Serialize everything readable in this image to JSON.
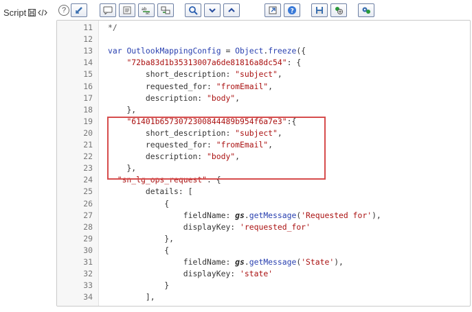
{
  "field": {
    "label": "Script",
    "save_icon": "save-icon",
    "code_icon": "code-icon",
    "help_text": "?"
  },
  "toolbar": {
    "buttons": [
      {
        "name": "toggle-fullscreen-icon"
      },
      {
        "name": "comment-icon"
      },
      {
        "name": "format-code-icon"
      },
      {
        "name": "replace-icon"
      },
      {
        "name": "replace-all-icon"
      },
      {
        "name": "search-icon"
      },
      {
        "name": "find-next-icon"
      },
      {
        "name": "find-previous-icon"
      },
      {
        "name": "open-icon"
      },
      {
        "name": "help-icon"
      },
      {
        "name": "save-icon"
      },
      {
        "name": "script-debugger-icon"
      },
      {
        "name": "settings-icon"
      }
    ]
  },
  "editor": {
    "lines": [
      {
        "n": "11",
        "t": [
          [
            "com",
            "*/"
          ]
        ]
      },
      {
        "n": "12",
        "t": []
      },
      {
        "n": "13",
        "t": [
          [
            "kw",
            "var "
          ],
          [
            "var",
            "OutlookMappingConfig"
          ],
          [
            "p",
            " = "
          ],
          [
            "var",
            "Object"
          ],
          [
            "p",
            "."
          ],
          [
            "var",
            "freeze"
          ],
          [
            "p",
            "({"
          ]
        ]
      },
      {
        "n": "14",
        "t": [
          [
            "p",
            "    "
          ],
          [
            "str",
            "\"72ba83d1b35313007a6de81816a8dc54\""
          ],
          [
            "p",
            ": {"
          ]
        ]
      },
      {
        "n": "15",
        "t": [
          [
            "p",
            "        short_description: "
          ],
          [
            "str",
            "\"subject\""
          ],
          [
            "p",
            ","
          ]
        ]
      },
      {
        "n": "16",
        "t": [
          [
            "p",
            "        requested_for: "
          ],
          [
            "str",
            "\"fromEmail\""
          ],
          [
            "p",
            ","
          ]
        ]
      },
      {
        "n": "17",
        "t": [
          [
            "p",
            "        description: "
          ],
          [
            "str",
            "\"body\""
          ],
          [
            "p",
            ","
          ]
        ]
      },
      {
        "n": "18",
        "t": [
          [
            "p",
            "    },"
          ]
        ]
      },
      {
        "n": "19",
        "t": [
          [
            "p",
            "    "
          ],
          [
            "str",
            "\"61401b6573072300844489b954f6a7e3\""
          ],
          [
            "p",
            ":{"
          ]
        ]
      },
      {
        "n": "20",
        "t": [
          [
            "p",
            "        short_description: "
          ],
          [
            "str",
            "\"subject\""
          ],
          [
            "p",
            ","
          ]
        ]
      },
      {
        "n": "21",
        "t": [
          [
            "p",
            "        requested_for: "
          ],
          [
            "str",
            "\"fromEmail\""
          ],
          [
            "p",
            ","
          ]
        ]
      },
      {
        "n": "22",
        "t": [
          [
            "p",
            "        description: "
          ],
          [
            "str",
            "\"body\""
          ],
          [
            "p",
            ","
          ]
        ]
      },
      {
        "n": "23",
        "t": [
          [
            "p",
            "    },"
          ]
        ]
      },
      {
        "n": "24",
        "t": [
          [
            "p",
            "  "
          ],
          [
            "str",
            "\"sn_lg_ops_request\""
          ],
          [
            "p",
            ": {"
          ]
        ]
      },
      {
        "n": "25",
        "t": [
          [
            "p",
            "        details: ["
          ]
        ]
      },
      {
        "n": "26",
        "t": [
          [
            "p",
            "            {"
          ]
        ]
      },
      {
        "n": "27",
        "t": [
          [
            "p",
            "                fieldName: "
          ],
          [
            "bold",
            "gs"
          ],
          [
            "p",
            "."
          ],
          [
            "var",
            "getMessage"
          ],
          [
            "p",
            "("
          ],
          [
            "str",
            "'Requested for'"
          ],
          [
            "p",
            "),"
          ]
        ]
      },
      {
        "n": "28",
        "t": [
          [
            "p",
            "                displayKey: "
          ],
          [
            "str",
            "'requested_for'"
          ]
        ]
      },
      {
        "n": "29",
        "t": [
          [
            "p",
            "            },"
          ]
        ]
      },
      {
        "n": "30",
        "t": [
          [
            "p",
            "            {"
          ]
        ]
      },
      {
        "n": "31",
        "t": [
          [
            "p",
            "                fieldName: "
          ],
          [
            "bold",
            "gs"
          ],
          [
            "p",
            "."
          ],
          [
            "var",
            "getMessage"
          ],
          [
            "p",
            "("
          ],
          [
            "str",
            "'State'"
          ],
          [
            "p",
            "),"
          ]
        ]
      },
      {
        "n": "32",
        "t": [
          [
            "p",
            "                displayKey: "
          ],
          [
            "str",
            "'state'"
          ]
        ]
      },
      {
        "n": "33",
        "t": [
          [
            "p",
            "            }"
          ]
        ]
      },
      {
        "n": "34",
        "t": [
          [
            "p",
            "        ],"
          ]
        ]
      }
    ]
  },
  "colors": {
    "keyword": "#2a41b0",
    "string": "#a11111",
    "highlight_border": "#d64b4b"
  }
}
